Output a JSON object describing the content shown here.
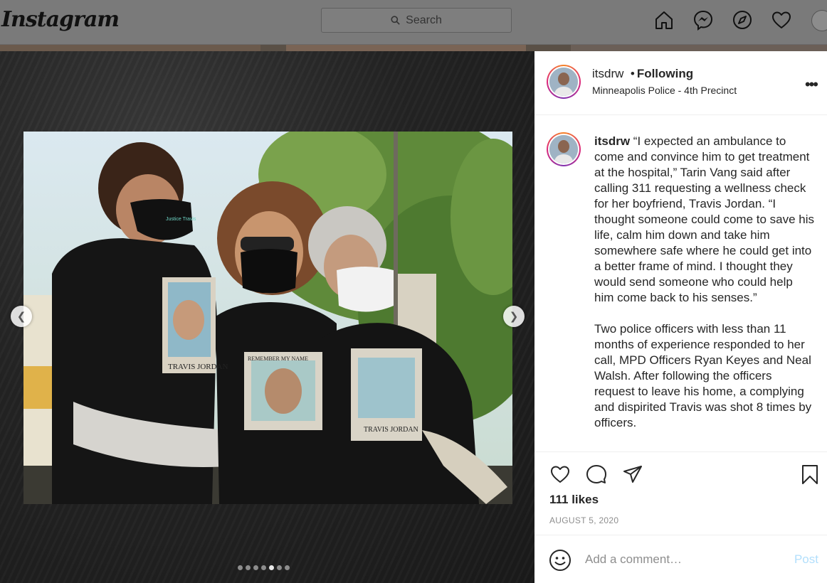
{
  "header": {
    "logo": "Instagram",
    "search": {
      "placeholder": "Search"
    },
    "icons": [
      "home-icon",
      "messenger-icon",
      "explore-icon",
      "heart-icon",
      "profile-avatar"
    ]
  },
  "carousel": {
    "prev_icon": "chevron-left-icon",
    "next_icon": "chevron-right-icon",
    "slide_count": 7,
    "active_index": 4,
    "shirt_text_1": "TRAVIS JORDAN",
    "shirt_text_2": "REMEMBER MY NAME",
    "shirt_text_3": "TRAVIS JORDAN",
    "mask_text": "Justice Travis"
  },
  "post": {
    "username": "itsdrw",
    "follow_bullet": "•",
    "follow_status": "Following",
    "location": "Minneapolis Police - 4th Precinct",
    "more_label": "•••",
    "caption": {
      "username": "itsdrw",
      "paragraph1": "“I expected an ambulance to come and convince him to get treatment at the hospital,” Tarin Vang said after calling 311 requesting a wellness check for her boyfriend, Travis Jordan. “I thought someone could come to save his life, calm him down and take him somewhere safe where he could get into a better frame of mind. I thought they would send someone who could help him come back to his senses.”",
      "paragraph2": "Two police officers with less than 11 months of experience responded to her call, MPD Officers Ryan Keyes and Neal Walsh. After following the officers request to leave his home, a complying and dispirited Travis was shot 8 times by officers."
    },
    "likes": "111 likes",
    "date": "AUGUST 5, 2020",
    "comment_placeholder": "Add a comment…",
    "post_label": "Post"
  },
  "colors": {
    "accent_disabled": "#b2dffc",
    "text": "#262626",
    "muted": "#8e8e8e"
  }
}
